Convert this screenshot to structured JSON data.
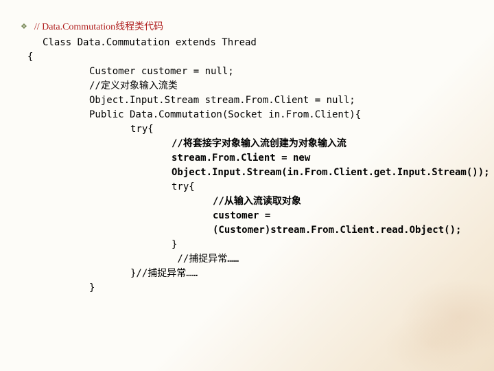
{
  "title": "// Data.Commutation线程类代码",
  "decl": "Class Data.Commutation extends Thread",
  "brace_open": "{",
  "l1": "Customer customer = null;",
  "l2": "//定义对象输入流类",
  "l3": "Object.Input.Stream stream.From.Client = null;",
  "l4": "Public Data.Commutation(Socket in.From.Client){",
  "l5": "try{",
  "l6": "//将套接字对象输入流创建为对象输入流",
  "l7": "stream.From.Client = new",
  "l8": "Object.Input.Stream(in.From.Client.get.Input.Stream());",
  "l9": "try{",
  "l10": "//从输入流读取对象",
  "l11": "customer =",
  "l12": "(Customer)stream.From.Client.read.Object();",
  "l13": "}",
  "l14": " //捕捉异常……",
  "l15": "}//捕捉异常……",
  "l16": "}"
}
